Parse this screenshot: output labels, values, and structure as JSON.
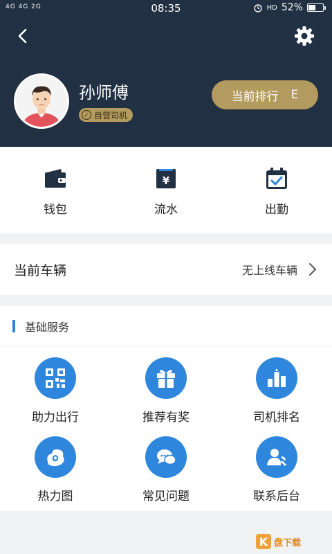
{
  "status_bar": {
    "network": "4G 4G 2G",
    "time": "08:35",
    "hd": "HD",
    "battery": "52%",
    "battery_level": 0.52
  },
  "header": {
    "driver_name": "孙师傅",
    "badge": "自营司机",
    "rank_label": "当前排行",
    "rank_value": "E"
  },
  "quick_actions": [
    {
      "label": "钱包",
      "icon": "wallet-icon"
    },
    {
      "label": "流水",
      "icon": "yen-ledger-icon"
    },
    {
      "label": "出勤",
      "icon": "calendar-check-icon"
    }
  ],
  "vehicle": {
    "title": "当前车辆",
    "value": "无上线车辆"
  },
  "services": {
    "title": "基础服务",
    "items": [
      {
        "label": "助力出行",
        "icon": "qr-code-icon"
      },
      {
        "label": "推荐有奖",
        "icon": "gift-icon"
      },
      {
        "label": "司机排名",
        "icon": "bar-chart-icon"
      },
      {
        "label": "热力图",
        "icon": "heatmap-icon"
      },
      {
        "label": "常见问题",
        "icon": "chat-bubbles-icon"
      },
      {
        "label": "联系后台",
        "icon": "contact-icon"
      }
    ]
  },
  "watermark": {
    "text": "盘下载"
  },
  "colors": {
    "header_bg": "#213042",
    "gold": "#b39a5e",
    "blue": "#2f86dd",
    "dark_icon": "#213042"
  }
}
